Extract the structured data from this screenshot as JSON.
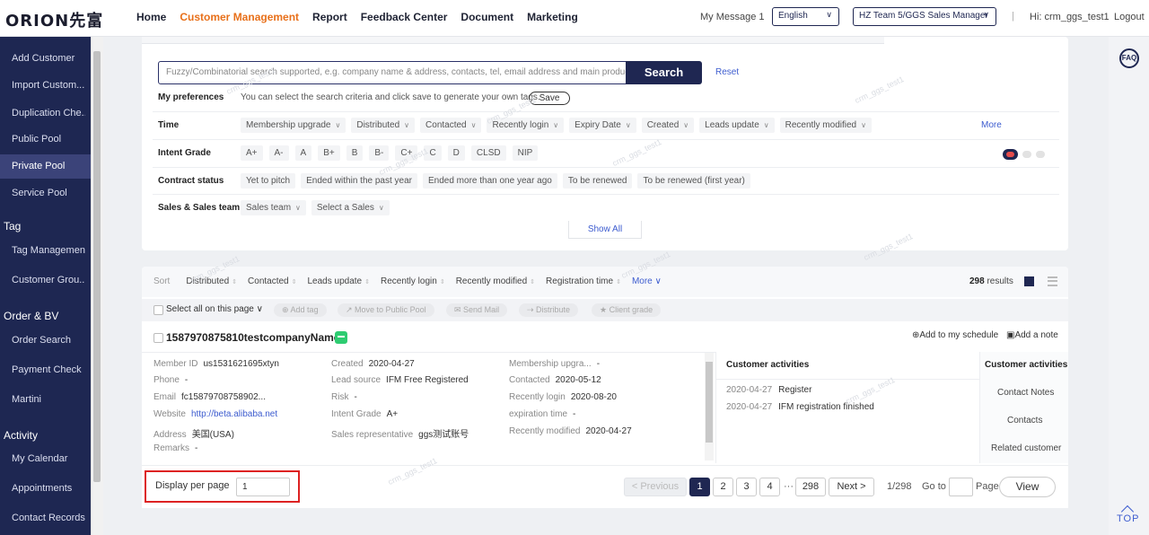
{
  "header": {
    "logo": "ORION先富",
    "nav": [
      "Home",
      "Customer Management",
      "Report",
      "Feedback Center",
      "Document",
      "Marketing"
    ],
    "my_message": "My Message 1",
    "language": "English",
    "team": "HZ Team 5/GGS Sales Manager",
    "greeting": "Hi: crm_ggs_test1",
    "logout": "Logout"
  },
  "sidebar": {
    "items_top": [
      "Add Customer",
      "Import Custom...",
      "Duplication Che...",
      "Public Pool",
      "Private Pool",
      "Service Pool"
    ],
    "section_tag": "Tag",
    "items_tag": [
      "Tag Management",
      "Customer Grou..."
    ],
    "section_order": "Order & BV",
    "items_order": [
      "Order Search",
      "Payment Check",
      "Martini"
    ],
    "section_activity": "Activity",
    "items_activity": [
      "My Calendar",
      "Appointments",
      "Contact Records"
    ]
  },
  "search": {
    "placeholder": "Fuzzy/Combinatorial search supported, e.g. company name & address, contacts, tel, email address and main products.",
    "button": "Search",
    "reset": "Reset"
  },
  "filters": {
    "preferences_label": "My preferences",
    "preferences_hint": "You can select the search criteria and click save to generate your own tags.",
    "save": "Save",
    "time_label": "Time",
    "time_chips": [
      "Membership upgrade",
      "Distributed",
      "Contacted",
      "Recently login",
      "Expiry Date",
      "Created",
      "Leads update",
      "Recently modified"
    ],
    "more": "More",
    "intent_label": "Intent Grade",
    "intent_chips": [
      "A+",
      "A-",
      "A",
      "B+",
      "B",
      "B-",
      "C+",
      "C",
      "D",
      "CLSD",
      "NIP"
    ],
    "contract_label": "Contract status",
    "contract_chips": [
      "Yet to pitch",
      "Ended within the past year",
      "Ended more than one year ago",
      "To be renewed",
      "To be renewed (first year)"
    ],
    "team_label": "Sales & Sales team",
    "team_chips": [
      "Sales team",
      "Select a Sales"
    ],
    "show_all": "Show All"
  },
  "sort": {
    "label": "Sort",
    "items": [
      "Distributed",
      "Contacted",
      "Leads update",
      "Recently login",
      "Recently modified",
      "Registration time"
    ],
    "more": "More",
    "results_count": "298",
    "results_label": "results"
  },
  "actions": {
    "select_all": "Select all on this page",
    "buttons": [
      "Add tag",
      "Move to Public Pool",
      "Send Mail",
      "Distribute",
      "Client grade"
    ]
  },
  "customer": {
    "name": "1587970875810testcompanyName",
    "add_schedule": "Add to my schedule",
    "add_note": "Add a note",
    "col1": [
      {
        "k": "Member ID",
        "v": "us1531621695xtyn"
      },
      {
        "k": "Phone",
        "v": "-"
      },
      {
        "k": "Email",
        "v": "fc15879708758902..."
      },
      {
        "k": "Website",
        "v": "http://beta.alibaba.net"
      },
      {
        "k": "Address",
        "v": "美国(USA)"
      },
      {
        "k": "Remarks",
        "v": "-"
      }
    ],
    "col2": [
      {
        "k": "Created",
        "v": "2020-04-27"
      },
      {
        "k": "Lead source",
        "v": "IFM Free Registered"
      },
      {
        "k": "Risk",
        "v": "-"
      },
      {
        "k": "Intent Grade",
        "v": "A+"
      },
      {
        "k": "Sales representative",
        "v": "ggs测试账号"
      }
    ],
    "col3": [
      {
        "k": "Membership upgra...",
        "v": "-"
      },
      {
        "k": "Contacted",
        "v": "2020-05-12"
      },
      {
        "k": "Recently login",
        "v": "2020-08-20"
      },
      {
        "k": "expiration time",
        "v": "-"
      },
      {
        "k": "Recently modified",
        "v": "2020-04-27"
      }
    ],
    "activities_title": "Customer activities",
    "activities": [
      {
        "date": "2020-04-27",
        "event": "Register"
      },
      {
        "date": "2020-04-27",
        "event": "IFM registration finished"
      }
    ],
    "side_title": "Customer activities",
    "side_items": [
      "Contact Notes",
      "Contacts",
      "Related customer"
    ]
  },
  "pager": {
    "display_label": "Display per page",
    "per_page": "1",
    "prev": "< Previous",
    "pages": [
      "1",
      "2",
      "3",
      "4"
    ],
    "ellipsis": "···",
    "last": "298",
    "next": "Next >",
    "position": "1/298",
    "goto": "Go to",
    "page_word": "Page",
    "view": "View"
  },
  "rail": {
    "faq": "FAQ",
    "top": "TOP"
  },
  "watermark": "crm_ggs_test1"
}
